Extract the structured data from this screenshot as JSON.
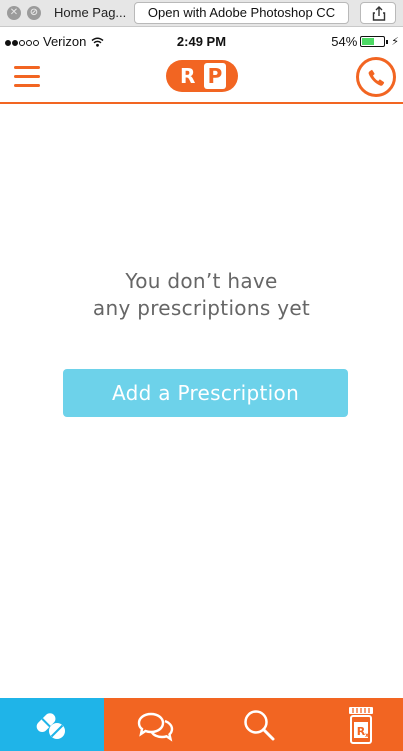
{
  "window": {
    "title": "Home Pag...",
    "open_with_label": "Open with Adobe Photoshop CC"
  },
  "status_bar": {
    "carrier": "Verizon",
    "time": "2:49 PM",
    "battery": "54%",
    "battery_level": 0.54,
    "signal_bars_filled": 2,
    "signal_bars_total": 5
  },
  "header": {
    "logo_left": "R",
    "logo_right": "P"
  },
  "main": {
    "empty_line1": "You don’t have",
    "empty_line2": "any prescriptions yet",
    "add_button": "Add a Prescription"
  },
  "tabs": [
    {
      "name": "pills",
      "icon": "pills-icon",
      "active": true
    },
    {
      "name": "chat",
      "icon": "chat-icon",
      "active": false
    },
    {
      "name": "search",
      "icon": "search-icon",
      "active": false
    },
    {
      "name": "rx",
      "icon": "rx-bottle-icon",
      "active": false
    }
  ],
  "colors": {
    "brand_orange": "#f26522",
    "accent_blue": "#1fb4e8",
    "button_blue": "#6dd2ea"
  }
}
